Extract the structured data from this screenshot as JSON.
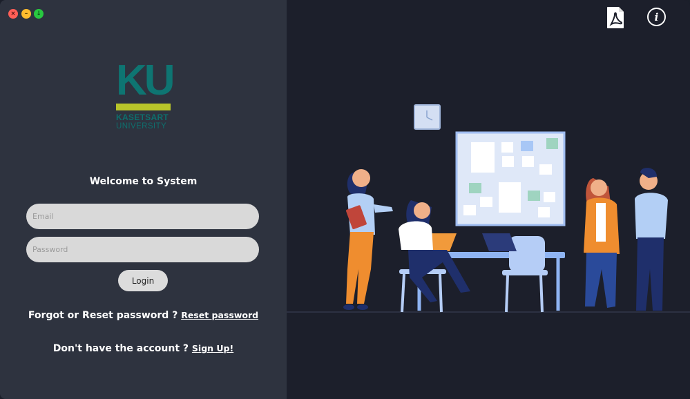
{
  "window": {
    "controls": [
      "close",
      "minimize",
      "maximize"
    ]
  },
  "logo": {
    "mark": "KU",
    "line1": "KASETSART",
    "line2": "UNIVERSITY",
    "colors": {
      "teal": "#0e7572",
      "bar": "#b8c52a"
    }
  },
  "login": {
    "title": "Welcome to System",
    "email_placeholder": "Email",
    "password_placeholder": "Password",
    "login_label": "Login",
    "forgot_text": "Forgot or Reset password ?",
    "reset_link": "Reset password",
    "signup_text": "Don't have the account ?",
    "signup_link": "Sign Up!"
  },
  "toolbar": {
    "pdf_icon": "pdf-icon",
    "info_icon": "info-icon",
    "info_glyph": "i"
  },
  "colors": {
    "left_bg": "#2e333f",
    "right_bg": "#1c1f2b",
    "field_bg": "#d9d9d9"
  }
}
